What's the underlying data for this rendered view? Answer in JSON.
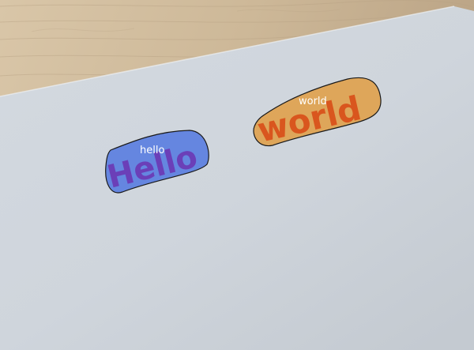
{
  "annotations": [
    {
      "label": "hello",
      "handwritten_text": "Hello",
      "highlight_color": "#5b7fe0",
      "ink_color": "#6b3fb8"
    },
    {
      "label": "world",
      "handwritten_text": "world",
      "highlight_color": "#e0a24e",
      "ink_color": "#d9561e"
    }
  ],
  "colors": {
    "table_wood": "#d4c2a6",
    "paper": "#d6dbe1",
    "outline": "#1a1a1a"
  }
}
